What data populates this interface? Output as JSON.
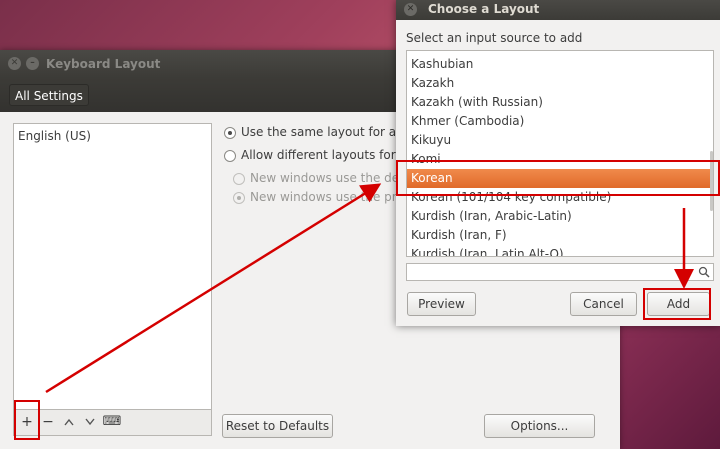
{
  "keyboard_window": {
    "title": "Keyboard Layout",
    "all_settings": "All Settings",
    "layouts": [
      "English (US)"
    ],
    "options": {
      "same_layout": "Use the same layout for all w",
      "different_layouts": "Allow different layouts for in",
      "new_windows_default": "New windows use the defa",
      "new_windows_previous": "New windows use the prev"
    },
    "toolbar": {
      "add": "+",
      "remove": "−",
      "up": "^",
      "down": "v",
      "keyboard": "⌨"
    },
    "reset_button": "Reset to Defaults",
    "options_button": "Options..."
  },
  "dialog": {
    "title": "Choose a Layout",
    "subtitle": "Select an input source to add",
    "items": [
      "Kashubian",
      "Kazakh",
      "Kazakh (with Russian)",
      "Khmer (Cambodia)",
      "Kikuyu",
      "Komi",
      "Korean",
      "Korean (101/104 key compatible)",
      "Kurdish (Iran, Arabic-Latin)",
      "Kurdish (Iran, F)",
      "Kurdish (Iran, Latin Alt-Q)"
    ],
    "selected": "Korean",
    "search_value": "",
    "preview_button": "Preview",
    "cancel_button": "Cancel",
    "add_button": "Add"
  },
  "colors": {
    "selection": "#e9733a",
    "annotation": "#d40000"
  }
}
